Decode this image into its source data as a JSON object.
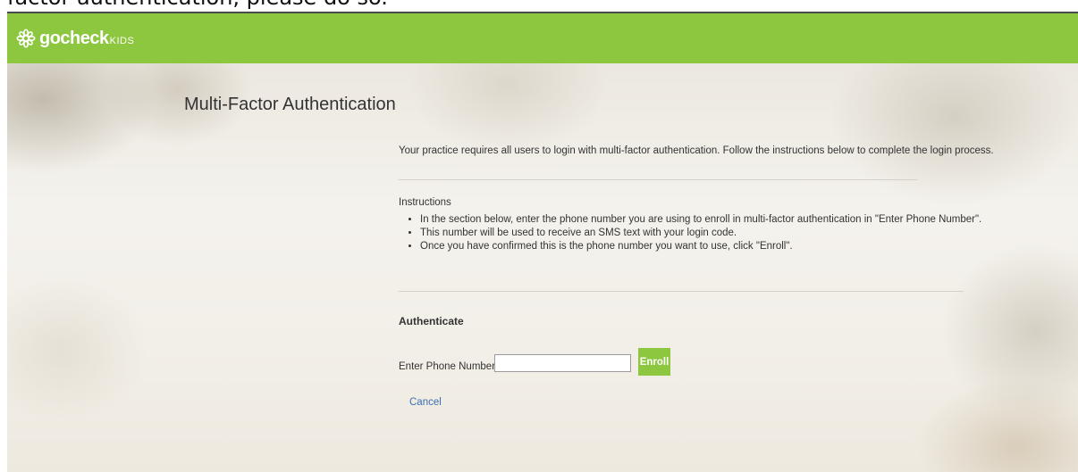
{
  "caption": {
    "text": "factor authentication, please do so."
  },
  "header": {
    "logo_word": "gocheck",
    "logo_sub": "KIDS",
    "logo_icon": "flower-logo-icon",
    "bg_color": "#8dc63f"
  },
  "main": {
    "title": "Multi-Factor Authentication",
    "intro": "Your practice requires all users to login with multi-factor authentication. Follow the instructions below to complete the login process.",
    "instructions_heading": "Instructions",
    "instructions": [
      "In the section below, enter the phone number you are using to enroll in multi-factor authentication in \"Enter Phone Number\".",
      "This number will be used to receive an SMS text with your login code.",
      "Once you have confirmed this is the phone number you want to use, click \"Enroll\"."
    ],
    "auth_heading": "Authenticate",
    "phone_label": "Enter Phone Number",
    "phone_value": "",
    "enroll_label": "Enroll",
    "cancel_label": "Cancel"
  },
  "colors": {
    "accent": "#8dc63f",
    "link": "#3a6fb5"
  }
}
